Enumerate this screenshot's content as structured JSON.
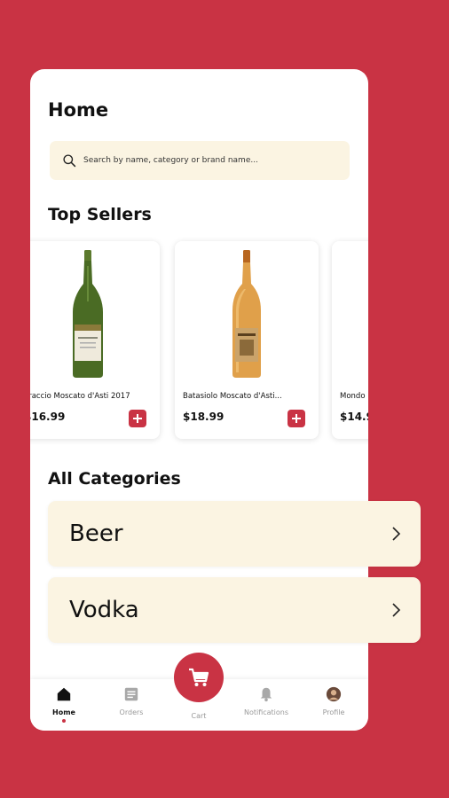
{
  "home": {
    "title": "Home",
    "search_placeholder": "Search by name, category or brand name..."
  },
  "top_sellers": {
    "title": "Top Sellers",
    "products": [
      {
        "name": "araccio Moscato d'Asti 2017",
        "price": "$16.99"
      },
      {
        "name": "Batasiolo Moscato d'Asti...",
        "price": "$18.99"
      },
      {
        "name": "Mondo",
        "price": "$14.9"
      }
    ]
  },
  "categories": {
    "title": "All Categories",
    "items": [
      {
        "label": "Beer"
      },
      {
        "label": "Vodka"
      }
    ]
  },
  "tabbar": {
    "home": "Home",
    "orders": "Orders",
    "cart": "Cart",
    "notifications": "Notifications",
    "profile": "Profile"
  },
  "colors": {
    "brand": "#c93344",
    "cream": "#fbf4e2",
    "inactive_tab": "#9a9a9a"
  },
  "icons": [
    "search-icon",
    "add-icon",
    "chevron-right-icon",
    "home-icon",
    "orders-icon",
    "cart-icon",
    "bell-icon",
    "avatar"
  ]
}
